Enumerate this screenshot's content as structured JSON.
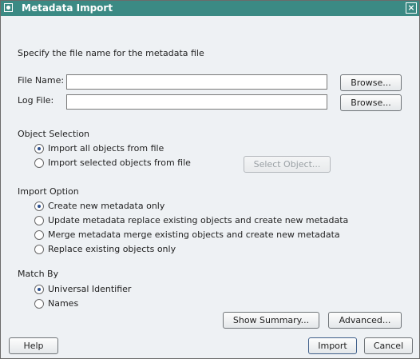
{
  "window": {
    "title": "Metadata Import",
    "close_symbol": "×"
  },
  "instruction": "Specify the file name for the metadata file",
  "file_name": {
    "label": "File Name:",
    "value": "",
    "browse_label": "Browse..."
  },
  "log_file": {
    "label": "Log File:",
    "value": "",
    "browse_label": "Browse..."
  },
  "object_selection": {
    "heading": "Object Selection",
    "options": [
      {
        "label": "Import all objects from file",
        "selected": true
      },
      {
        "label": "Import selected objects from file",
        "selected": false
      }
    ],
    "select_object_label": "Select Object..."
  },
  "import_option": {
    "heading": "Import Option",
    "options": [
      {
        "label": "Create new metadata only",
        "selected": true
      },
      {
        "label": "Update metadata replace existing objects and create new metadata",
        "selected": false
      },
      {
        "label": "Merge metadata merge existing objects and create new metadata",
        "selected": false
      },
      {
        "label": "Replace existing objects only",
        "selected": false
      }
    ]
  },
  "match_by": {
    "heading": "Match By",
    "options": [
      {
        "label": "Universal Identifier",
        "selected": true
      },
      {
        "label": "Names",
        "selected": false
      }
    ]
  },
  "buttons": {
    "show_summary": "Show Summary...",
    "advanced": "Advanced...",
    "help": "Help",
    "import": "Import",
    "cancel": "Cancel"
  }
}
